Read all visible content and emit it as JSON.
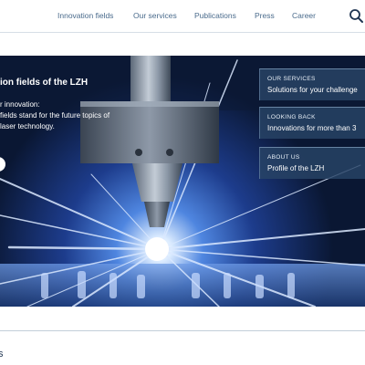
{
  "nav": {
    "items": [
      "Innovation fields",
      "Our services",
      "Publications",
      "Press",
      "Career"
    ],
    "search_icon": "search-icon"
  },
  "hero": {
    "title": "ion fields of the LZH",
    "lines": [
      "r innovation:",
      " fields stand for the future topics of",
      "laser technology."
    ],
    "promos": [
      {
        "kicker": "OUR SERVICES",
        "title": "Solutions for your challenge"
      },
      {
        "kicker": "LOOKING BACK",
        "title": "Innovations for more than 3"
      },
      {
        "kicker": "ABOUT US",
        "title": "Profile of the LZH"
      }
    ]
  },
  "section": {
    "heading_fragment": "s"
  },
  "colors": {
    "nav_text": "#4a6b8c",
    "promo_bg": "#284466",
    "hero_bg": "#0b1730"
  }
}
